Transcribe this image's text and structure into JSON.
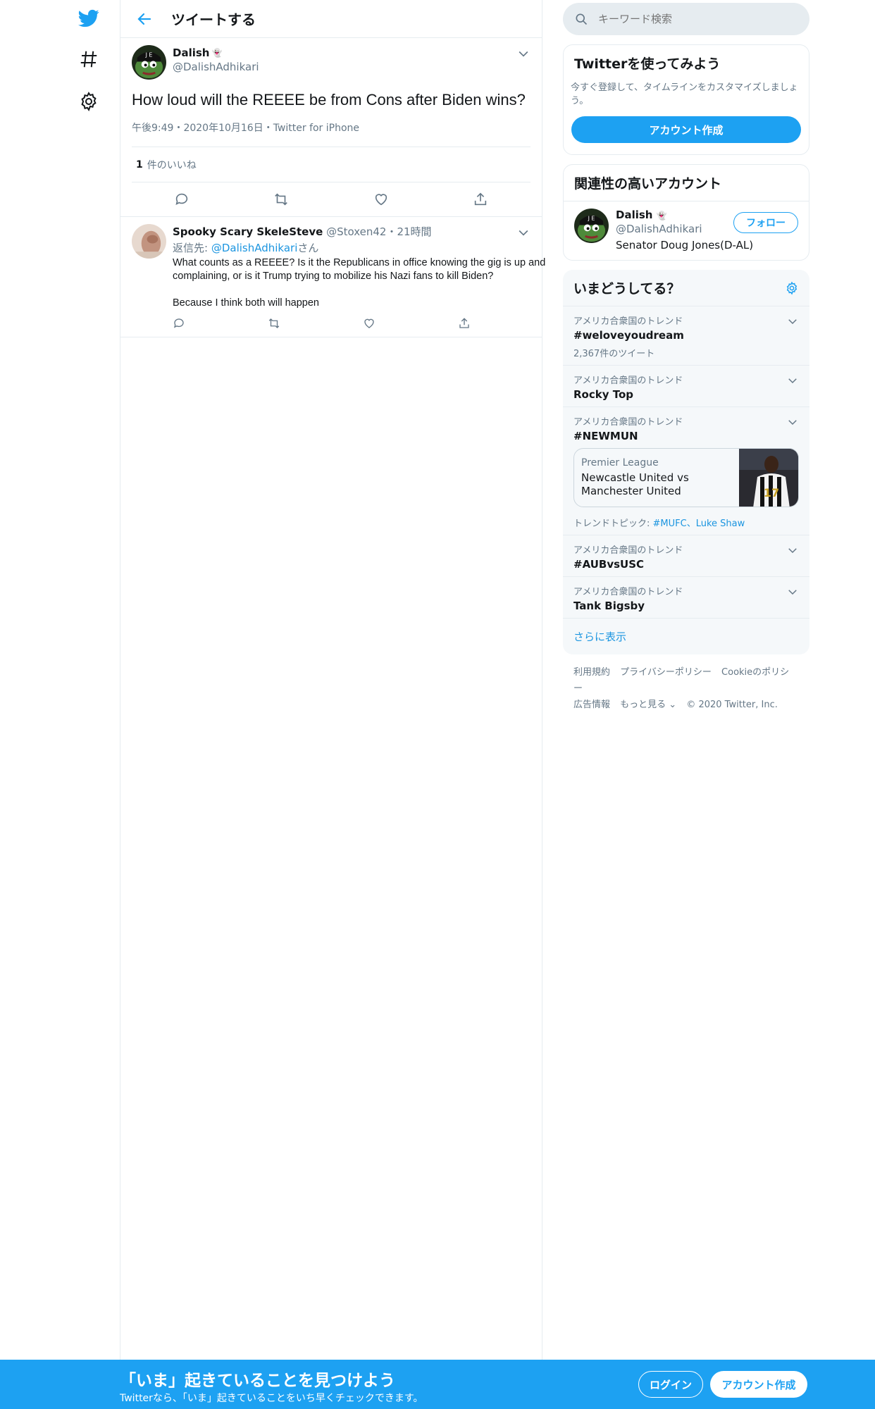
{
  "header": {
    "title": "ツイートする"
  },
  "tweet": {
    "author_name": "Dalish",
    "author_badge": "👻",
    "author_handle": "@DalishAdhikari",
    "text": "How loud will the REEEE be from Cons after Biden wins?",
    "meta": "午後9:49・2020年10月16日・Twitter for iPhone",
    "likes_count": "1",
    "likes_label": "件のいいね"
  },
  "reply": {
    "name": "Spooky Scary SkeleSteve",
    "meta": "@Stoxen42・21時間",
    "replying_prefix": "返信先: ",
    "replying_link": "@DalishAdhikari",
    "replying_suffix": "さん",
    "text": "What counts as a REEEE? Is it the Republicans in office knowing the gig is up and complaining, or is it Trump trying to mobilize his Nazi fans to kill Biden?\n\nBecause I think both will happen"
  },
  "search": {
    "placeholder": "キーワード検索"
  },
  "signup_card": {
    "title": "Twitterを使ってみよう",
    "desc": "今すぐ登録して、タイムラインをカスタマイズしましょう。",
    "button": "アカウント作成"
  },
  "related": {
    "title": "関連性の高いアカウント",
    "name": "Dalish",
    "badge": "👻",
    "handle": "@DalishAdhikari",
    "bio": "Senator Doug Jones(D-AL)",
    "follow": "フォロー"
  },
  "trends": {
    "title": "いまどうしてる？",
    "items": [
      {
        "context": "アメリカ合衆国のトレンド",
        "name": "#weloveyoudream",
        "count": "2,367件のツイート"
      },
      {
        "context": "アメリカ合衆国のトレンド",
        "name": "Rocky Top"
      },
      {
        "context": "アメリカ合衆国のトレンド",
        "name": "#NEWMUN"
      },
      {
        "context": "アメリカ合衆国のトレンド",
        "name": "#AUBvsUSC"
      },
      {
        "context": "アメリカ合衆国のトレンド",
        "name": "Tank Bigsby"
      }
    ],
    "event": {
      "league": "Premier League",
      "match": "Newcastle United vs Manchester United",
      "topics_prefix": "トレンドトピック: ",
      "topics": "#MUFC、Luke Shaw"
    },
    "more": "さらに表示"
  },
  "footer": {
    "links": [
      "利用規約",
      "プライバシーポリシー",
      "Cookieのポリシー",
      "広告情報",
      "もっと見る ⌄",
      "© 2020 Twitter, Inc."
    ]
  },
  "banner": {
    "title": "「いま」起きていることを見つけよう",
    "sub": "Twitterなら、「いま」起きていることをいち早くチェックできます。",
    "login": "ログイン",
    "signup": "アカウント作成"
  },
  "colors": {
    "accent": "#1da1f2",
    "link": "#1b95e0",
    "muted": "#657786",
    "border": "#e6ecf0"
  }
}
